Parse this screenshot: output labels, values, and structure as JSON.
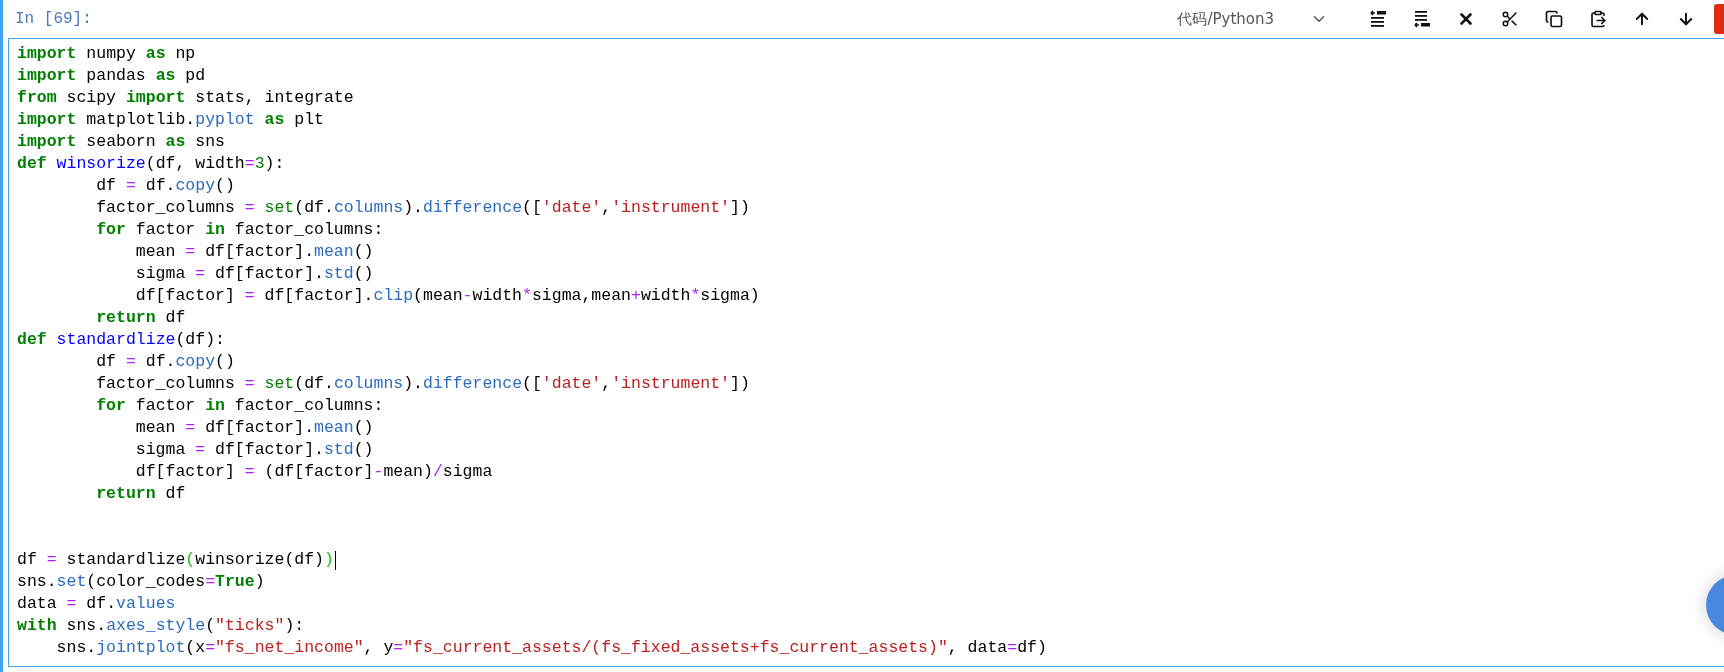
{
  "cell": {
    "prompt": "In [69]:",
    "toolbar": {
      "cell_type": "代码/Python3"
    },
    "lines": [
      {
        "kind": "code",
        "tokens": [
          {
            "kind": "kw",
            "text": "import"
          },
          {
            "kind": "plain",
            "text": " numpy "
          },
          {
            "kind": "kw",
            "text": "as"
          },
          {
            "kind": "plain",
            "text": " np"
          }
        ]
      },
      {
        "kind": "code",
        "tokens": [
          {
            "kind": "kw",
            "text": "import"
          },
          {
            "kind": "plain",
            "text": " pandas "
          },
          {
            "kind": "kw",
            "text": "as"
          },
          {
            "kind": "plain",
            "text": " pd"
          }
        ]
      },
      {
        "kind": "code",
        "tokens": [
          {
            "kind": "kw",
            "text": "from"
          },
          {
            "kind": "plain",
            "text": " scipy "
          },
          {
            "kind": "kw",
            "text": "import"
          },
          {
            "kind": "plain",
            "text": " stats, integrate"
          }
        ]
      },
      {
        "kind": "code",
        "tokens": [
          {
            "kind": "kw",
            "text": "import"
          },
          {
            "kind": "plain",
            "text": " matplotlib."
          },
          {
            "kind": "attr",
            "text": "pyplot "
          },
          {
            "kind": "kw",
            "text": "as"
          },
          {
            "kind": "plain",
            "text": " plt"
          }
        ]
      },
      {
        "kind": "code",
        "tokens": [
          {
            "kind": "kw",
            "text": "import"
          },
          {
            "kind": "plain",
            "text": " seaborn "
          },
          {
            "kind": "kw",
            "text": "as"
          },
          {
            "kind": "plain",
            "text": " sns"
          }
        ]
      },
      {
        "kind": "code",
        "tokens": [
          {
            "kind": "kw",
            "text": "def "
          },
          {
            "kind": "name",
            "text": "winsorize"
          },
          {
            "kind": "plain",
            "text": "(df, width"
          },
          {
            "kind": "op",
            "text": "="
          },
          {
            "kind": "num",
            "text": "3"
          },
          {
            "kind": "plain",
            "text": "):"
          }
        ]
      },
      {
        "kind": "code",
        "tokens": [
          {
            "kind": "plain",
            "text": "        df "
          },
          {
            "kind": "op",
            "text": "="
          },
          {
            "kind": "plain",
            "text": " df."
          },
          {
            "kind": "attr",
            "text": "copy"
          },
          {
            "kind": "plain",
            "text": "()"
          }
        ]
      },
      {
        "kind": "code",
        "tokens": [
          {
            "kind": "plain",
            "text": "        factor_columns "
          },
          {
            "kind": "op",
            "text": "= "
          },
          {
            "kind": "builtin",
            "text": "set"
          },
          {
            "kind": "plain",
            "text": "(df."
          },
          {
            "kind": "attr",
            "text": "columns"
          },
          {
            "kind": "plain",
            "text": ")."
          },
          {
            "kind": "attr",
            "text": "difference"
          },
          {
            "kind": "plain",
            "text": "(["
          },
          {
            "kind": "str",
            "text": "'date'"
          },
          {
            "kind": "plain",
            "text": ","
          },
          {
            "kind": "str",
            "text": "'instrument'"
          },
          {
            "kind": "plain",
            "text": "])"
          }
        ]
      },
      {
        "kind": "code",
        "tokens": [
          {
            "kind": "kw",
            "text": "        for"
          },
          {
            "kind": "plain",
            "text": " factor "
          },
          {
            "kind": "kw",
            "text": "in"
          },
          {
            "kind": "plain",
            "text": " factor_columns:"
          }
        ]
      },
      {
        "kind": "code",
        "tokens": [
          {
            "kind": "plain",
            "text": "            mean "
          },
          {
            "kind": "op",
            "text": "="
          },
          {
            "kind": "plain",
            "text": " df[factor]."
          },
          {
            "kind": "attr",
            "text": "mean"
          },
          {
            "kind": "plain",
            "text": "()"
          }
        ]
      },
      {
        "kind": "code",
        "tokens": [
          {
            "kind": "plain",
            "text": "            sigma "
          },
          {
            "kind": "op",
            "text": "="
          },
          {
            "kind": "plain",
            "text": " df[factor]."
          },
          {
            "kind": "attr",
            "text": "std"
          },
          {
            "kind": "plain",
            "text": "()"
          }
        ]
      },
      {
        "kind": "code",
        "tokens": [
          {
            "kind": "plain",
            "text": "            df[factor] "
          },
          {
            "kind": "op",
            "text": "="
          },
          {
            "kind": "plain",
            "text": " df[factor]."
          },
          {
            "kind": "attr",
            "text": "clip"
          },
          {
            "kind": "plain",
            "text": "(mean"
          },
          {
            "kind": "op",
            "text": "-"
          },
          {
            "kind": "plain",
            "text": "width"
          },
          {
            "kind": "op",
            "text": "*"
          },
          {
            "kind": "plain",
            "text": "sigma,mean"
          },
          {
            "kind": "op",
            "text": "+"
          },
          {
            "kind": "plain",
            "text": "width"
          },
          {
            "kind": "op",
            "text": "*"
          },
          {
            "kind": "plain",
            "text": "sigma)"
          }
        ]
      },
      {
        "kind": "code",
        "tokens": [
          {
            "kind": "kw",
            "text": "        return"
          },
          {
            "kind": "plain",
            "text": " df"
          }
        ]
      },
      {
        "kind": "code",
        "tokens": [
          {
            "kind": "kw",
            "text": "def "
          },
          {
            "kind": "name",
            "text": "standardlize"
          },
          {
            "kind": "plain",
            "text": "(df):"
          }
        ]
      },
      {
        "kind": "code",
        "tokens": [
          {
            "kind": "plain",
            "text": "        df "
          },
          {
            "kind": "op",
            "text": "="
          },
          {
            "kind": "plain",
            "text": " df."
          },
          {
            "kind": "attr",
            "text": "copy"
          },
          {
            "kind": "plain",
            "text": "()"
          }
        ]
      },
      {
        "kind": "code",
        "tokens": [
          {
            "kind": "plain",
            "text": "        factor_columns "
          },
          {
            "kind": "op",
            "text": "= "
          },
          {
            "kind": "builtin",
            "text": "set"
          },
          {
            "kind": "plain",
            "text": "(df."
          },
          {
            "kind": "attr",
            "text": "columns"
          },
          {
            "kind": "plain",
            "text": ")."
          },
          {
            "kind": "attr",
            "text": "difference"
          },
          {
            "kind": "plain",
            "text": "(["
          },
          {
            "kind": "str",
            "text": "'date'"
          },
          {
            "kind": "plain",
            "text": ","
          },
          {
            "kind": "str",
            "text": "'instrument'"
          },
          {
            "kind": "plain",
            "text": "])"
          }
        ]
      },
      {
        "kind": "code",
        "tokens": [
          {
            "kind": "kw",
            "text": "        for"
          },
          {
            "kind": "plain",
            "text": " factor "
          },
          {
            "kind": "kw",
            "text": "in"
          },
          {
            "kind": "plain",
            "text": " factor_columns:"
          }
        ]
      },
      {
        "kind": "code",
        "tokens": [
          {
            "kind": "plain",
            "text": "            mean "
          },
          {
            "kind": "op",
            "text": "="
          },
          {
            "kind": "plain",
            "text": " df[factor]."
          },
          {
            "kind": "attr",
            "text": "mean"
          },
          {
            "kind": "plain",
            "text": "()"
          }
        ]
      },
      {
        "kind": "code",
        "tokens": [
          {
            "kind": "plain",
            "text": "            sigma "
          },
          {
            "kind": "op",
            "text": "="
          },
          {
            "kind": "plain",
            "text": " df[factor]."
          },
          {
            "kind": "attr",
            "text": "std"
          },
          {
            "kind": "plain",
            "text": "()"
          }
        ]
      },
      {
        "kind": "code",
        "tokens": [
          {
            "kind": "plain",
            "text": "            df[factor] "
          },
          {
            "kind": "op",
            "text": "="
          },
          {
            "kind": "plain",
            "text": " (df[factor]"
          },
          {
            "kind": "op",
            "text": "-"
          },
          {
            "kind": "plain",
            "text": "mean)"
          },
          {
            "kind": "op",
            "text": "/"
          },
          {
            "kind": "plain",
            "text": "sigma"
          }
        ]
      },
      {
        "kind": "code",
        "tokens": [
          {
            "kind": "kw",
            "text": "        return"
          },
          {
            "kind": "plain",
            "text": " df"
          }
        ]
      },
      {
        "kind": "blank"
      },
      {
        "kind": "blank"
      },
      {
        "kind": "code",
        "cursor": true,
        "tokens": [
          {
            "kind": "plain",
            "text": "df "
          },
          {
            "kind": "op",
            "text": "="
          },
          {
            "kind": "plain",
            "text": " standardlize"
          },
          {
            "kind": "match",
            "text": "("
          },
          {
            "kind": "plain",
            "text": "winsorize(df)"
          },
          {
            "kind": "match",
            "text": ")"
          }
        ]
      },
      {
        "kind": "code",
        "tokens": [
          {
            "kind": "plain",
            "text": "sns."
          },
          {
            "kind": "attr",
            "text": "set"
          },
          {
            "kind": "plain",
            "text": "(color_codes"
          },
          {
            "kind": "op",
            "text": "="
          },
          {
            "kind": "bool",
            "text": "True"
          },
          {
            "kind": "plain",
            "text": ")"
          }
        ]
      },
      {
        "kind": "code",
        "tokens": [
          {
            "kind": "plain",
            "text": "data "
          },
          {
            "kind": "op",
            "text": "="
          },
          {
            "kind": "plain",
            "text": " df."
          },
          {
            "kind": "attr",
            "text": "values"
          }
        ]
      },
      {
        "kind": "code",
        "tokens": [
          {
            "kind": "kw",
            "text": "with"
          },
          {
            "kind": "plain",
            "text": " sns."
          },
          {
            "kind": "attr",
            "text": "axes_style"
          },
          {
            "kind": "plain",
            "text": "("
          },
          {
            "kind": "str",
            "text": "\"ticks\""
          },
          {
            "kind": "plain",
            "text": "):"
          }
        ]
      },
      {
        "kind": "code",
        "tokens": [
          {
            "kind": "plain",
            "text": "    sns."
          },
          {
            "kind": "attr",
            "text": "jointplot"
          },
          {
            "kind": "plain",
            "text": "(x"
          },
          {
            "kind": "op",
            "text": "="
          },
          {
            "kind": "str",
            "text": "\"fs_net_income\""
          },
          {
            "kind": "plain",
            "text": ", y"
          },
          {
            "kind": "op",
            "text": "="
          },
          {
            "kind": "str",
            "text": "\"fs_current_assets/(fs_fixed_assets+fs_current_assets)\""
          },
          {
            "kind": "plain",
            "text": ", data"
          },
          {
            "kind": "op",
            "text": "="
          },
          {
            "kind": "plain",
            "text": "df)"
          }
        ]
      }
    ]
  }
}
